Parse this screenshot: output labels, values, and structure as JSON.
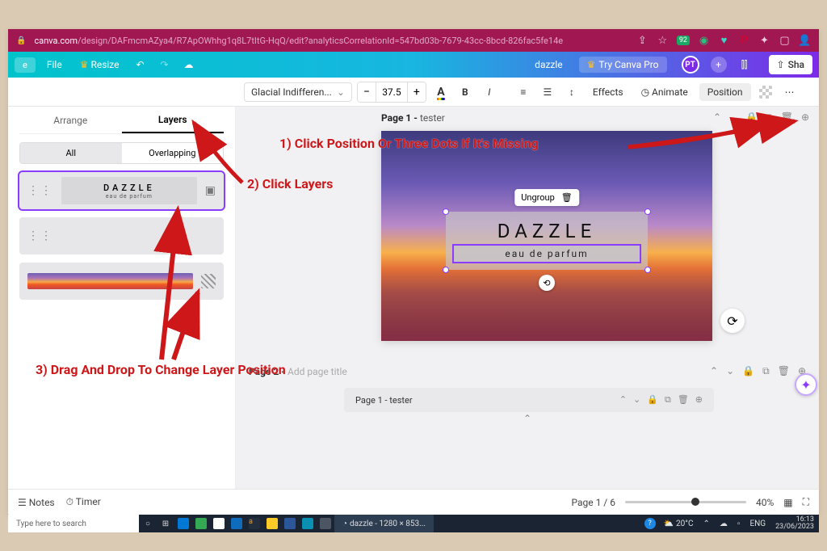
{
  "browser": {
    "url_domain": "canva.com",
    "url_path": "/design/DAFmcmAZya4/R7ApOWhhg1q8L7tItG-HqQ/edit?analyticsCorrelationId=547bd03b-7679-43cc-8bcd-826fac5fe14e",
    "badge": "92"
  },
  "topbar": {
    "file": "File",
    "resize": "Resize",
    "doc_title": "dazzle",
    "try_pro": "Try Canva Pro",
    "avatar": "PT",
    "share": "Sha"
  },
  "toolbar": {
    "font": "Glacial Indifferen...",
    "size": "37.5",
    "bold": "B",
    "italic": "I",
    "effects": "Effects",
    "animate": "Animate",
    "position": "Position"
  },
  "sidebar": {
    "tabs": {
      "arrange": "Arrange",
      "layers": "Layers"
    },
    "filter": {
      "all": "All",
      "overlap": "Overlapping"
    },
    "layer1": {
      "title": "DAZZLE",
      "subtitle": "eau de parfum"
    }
  },
  "page1": {
    "label": "Page 1 - ",
    "name": "tester"
  },
  "context": {
    "ungroup": "Ungroup"
  },
  "design": {
    "title": "DAZZLE",
    "subtitle": "eau de parfum"
  },
  "page2": {
    "label": "Page 2 - ",
    "placeholder": "Add page title"
  },
  "mini": {
    "label": "Page 1 - tester"
  },
  "footer": {
    "notes": "Notes",
    "timer": "Timer",
    "page_counter": "Page 1 / 6",
    "zoom": "40%"
  },
  "taskbar": {
    "search": "Type here to search",
    "active": "dazzle - 1280 × 853...",
    "temp": "20°C",
    "lang": "ENG",
    "time": "16:13",
    "date": "23/06/2023"
  },
  "annotations": {
    "a1": "1) Click Position Or Three Dots If It's Missing",
    "a2": "2) Click Layers",
    "a3": "3) Drag And Drop To Change Layer Position"
  }
}
